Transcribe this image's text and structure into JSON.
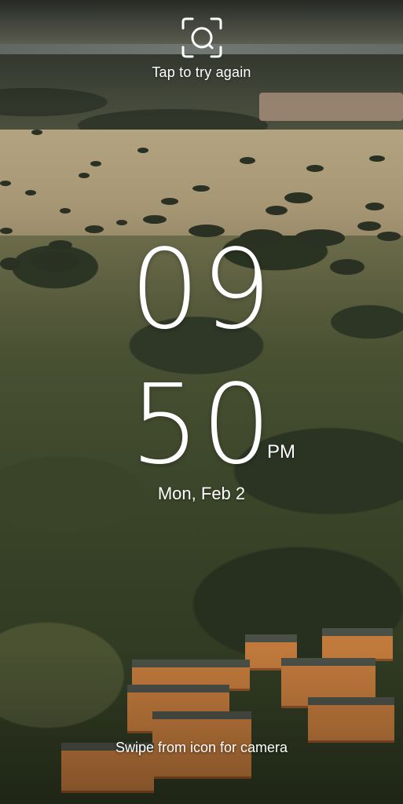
{
  "face_unlock": {
    "icon": "face-scan-icon",
    "hint": "Tap to try again"
  },
  "clock": {
    "hours": "09",
    "minutes": "50",
    "ampm": "PM",
    "date": "Mon, Feb 2"
  },
  "camera_hint": "Swipe from icon for camera"
}
